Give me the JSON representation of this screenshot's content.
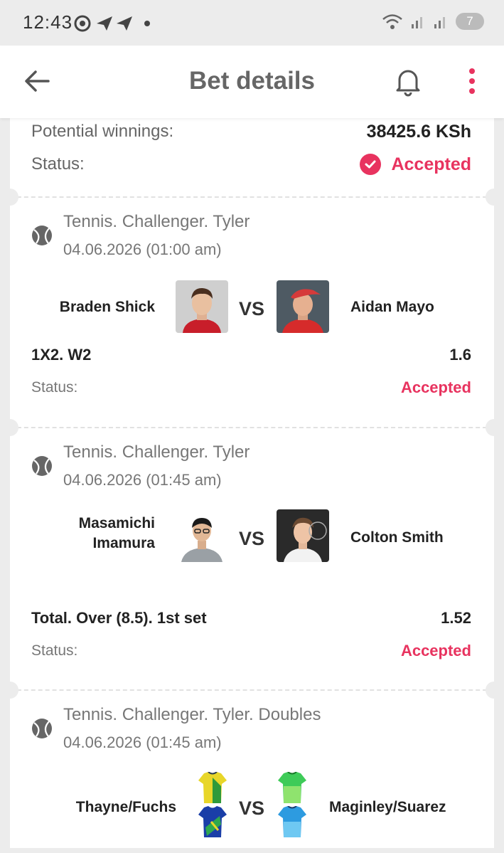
{
  "status_bar": {
    "time": "12:43",
    "battery": "7"
  },
  "header": {
    "title": "Bet details"
  },
  "summary": {
    "potential_winnings_label": "Potential winnings:",
    "potential_winnings_value": "38425.6 KSh",
    "status_label": "Status:",
    "status_value": "Accepted"
  },
  "events": [
    {
      "league": "Tennis. Challenger. Tyler",
      "date": "04.06.2026 (01:00 am)",
      "home": "Braden Shick",
      "away": "Aidan Mayo",
      "vs": "VS",
      "market": "1X2. W2",
      "odds": "1.6",
      "status_label": "Status:",
      "status_value": "Accepted"
    },
    {
      "league": "Tennis. Challenger. Tyler",
      "date": "04.06.2026 (01:45 am)",
      "home_line1": "Masamichi",
      "home_line2": "Imamura",
      "away": "Colton Smith",
      "vs": "VS",
      "market": "Total. Over (8.5). 1st set",
      "odds": "1.52",
      "status_label": "Status:",
      "status_value": "Accepted"
    },
    {
      "league": "Tennis. Challenger. Tyler. Doubles",
      "date": "04.06.2026 (01:45 am)",
      "home": "Thayne/Fuchs",
      "away": "Maginley/Suarez",
      "vs": "VS"
    }
  ],
  "colors": {
    "accent": "#e8335f",
    "background": "#ececec"
  },
  "icons": [
    "back-arrow-icon",
    "bell-icon",
    "more-vert-icon",
    "tennis-ball-icon",
    "check-circle-icon"
  ]
}
